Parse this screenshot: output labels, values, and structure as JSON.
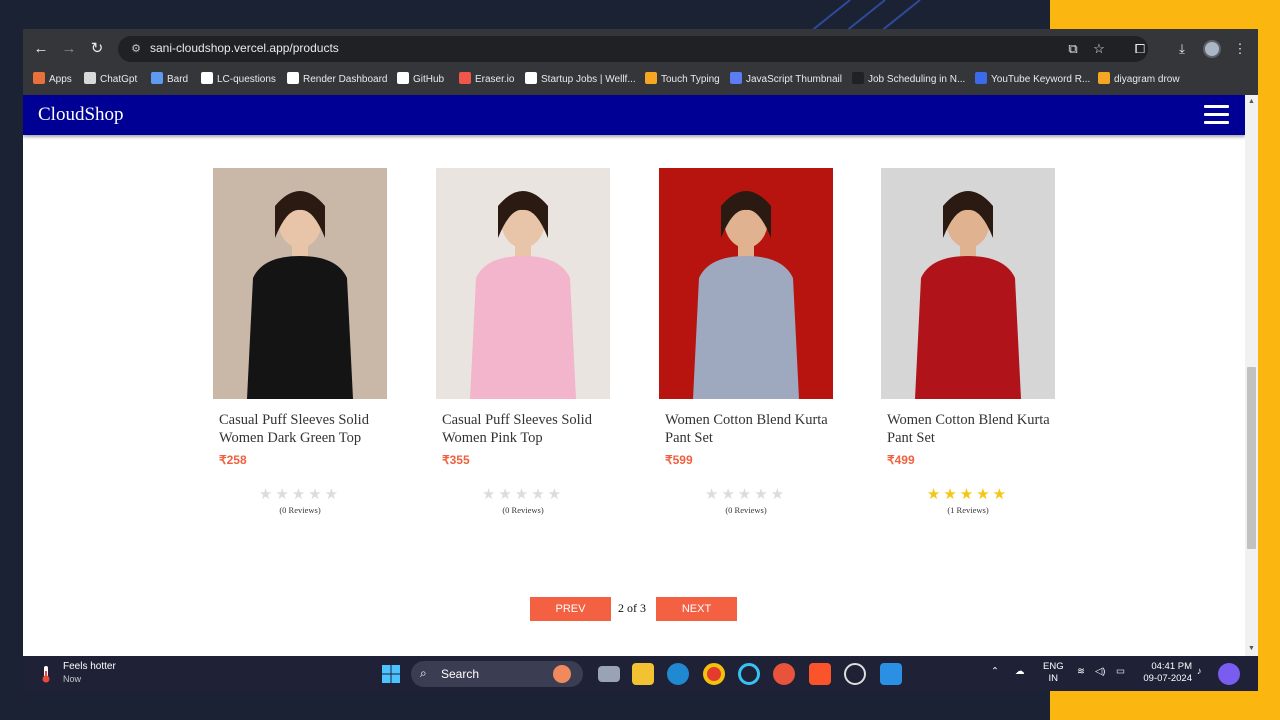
{
  "browser": {
    "url": "sani-cloudshop.vercel.app/products",
    "bookmarks": [
      {
        "label": "Apps",
        "color": "#e8713b"
      },
      {
        "label": "ChatGpt",
        "color": "#d9d9d9"
      },
      {
        "label": "Bard",
        "color": "#5e9bf0"
      },
      {
        "label": "LC-questions",
        "color": "#ffffff"
      },
      {
        "label": "Render Dashboard",
        "color": "#ffffff"
      },
      {
        "label": "GitHub",
        "color": "#ffffff"
      },
      {
        "label": "Eraser.io",
        "color": "#f0574a"
      },
      {
        "label": "Startup Jobs | Wellf...",
        "color": "#ffffff"
      },
      {
        "label": "Touch Typing",
        "color": "#f5a623"
      },
      {
        "label": "JavaScript Thumbnail",
        "color": "#5b7cf5"
      },
      {
        "label": "Job Scheduling in N...",
        "color": "#202124"
      },
      {
        "label": "YouTube Keyword R...",
        "color": "#3b6be8"
      },
      {
        "label": "diyagram drow",
        "color": "#f5a623"
      }
    ]
  },
  "site": {
    "brand": "CloudShop"
  },
  "products": [
    {
      "name": "Casual Puff Sleeves Solid Women Dark Green Top",
      "price": "₹258",
      "rating": 0,
      "reviews": "(0 Reviews)",
      "garment_color": "#141414",
      "bg_color": "#c9b7a8",
      "skin": "#e8c4a8"
    },
    {
      "name": "Casual Puff Sleeves Solid Women Pink Top",
      "price": "₹355",
      "rating": 0,
      "reviews": "(0 Reviews)",
      "garment_color": "#f3b5cb",
      "bg_color": "#e9e4df",
      "skin": "#e8c4a8"
    },
    {
      "name": "Women Cotton Blend Kurta Pant Set",
      "price": "₹599",
      "rating": 0,
      "reviews": "(0 Reviews)",
      "garment_color": "#9ea8bf",
      "bg_color": "#b8140f",
      "skin": "#e0b290"
    },
    {
      "name": "Women Cotton Blend Kurta Pant Set",
      "price": "₹499",
      "rating": 4.5,
      "reviews": "(1 Reviews)",
      "garment_color": "#b0141a",
      "bg_color": "#d6d6d6",
      "skin": "#e0b290"
    }
  ],
  "pagination": {
    "prev": "PREV",
    "info": "2 of 3",
    "next": "NEXT"
  },
  "taskbar": {
    "weather_title": "Feels hotter",
    "weather_sub": "Now",
    "search": "Search",
    "lang_line1": "ENG",
    "lang_line2": "IN",
    "time": "04:41 PM",
    "date": "09-07-2024"
  }
}
